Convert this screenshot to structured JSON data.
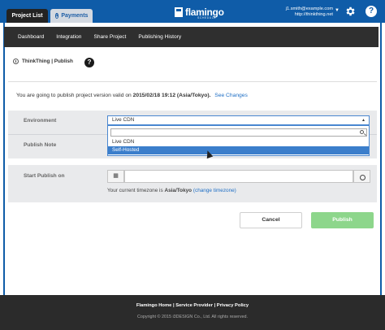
{
  "header": {
    "tabs": [
      {
        "label": "Project List"
      },
      {
        "label": "Payments",
        "icon": "payment-icon"
      }
    ],
    "logo_text": "flamingo",
    "logo_subtext": "SCHEDULE",
    "user_email": "j1.smith@example.com",
    "user_site": "http://thinkthing.net",
    "help_glyph": "?"
  },
  "nav": {
    "items": [
      "Dashboard",
      "Integration",
      "Share Project",
      "Publishing History"
    ]
  },
  "breadcrumb": {
    "text": "ThinkThing | Publish",
    "help": "?"
  },
  "notice": {
    "prefix": "You are going to publish project version valid on",
    "datetime": "2015/02/18 19:12 (Asia/Tokyo).",
    "link": "See Changes"
  },
  "form": {
    "environment_label": "Environment",
    "environment_value": "Live CDN",
    "environment_options": [
      "Live CDN",
      "Self-Hosted"
    ],
    "publish_note_label": "Publish Note",
    "start_publish_label": "Start Publish on",
    "timezone_prefix": "Your current timezone is",
    "timezone_value": "Asia/Tokyo",
    "timezone_link": "(change timezone)"
  },
  "buttons": {
    "cancel": "Cancel",
    "publish": "Publish"
  },
  "footer": {
    "links": "Flamingo Home | Service Provider | Privacy Policy",
    "copyright": "Copyright © 2015 i3DESIGN Co., Ltd. All rights reserved."
  },
  "colors": {
    "brand": "#0f5ca8",
    "publish": "#8dd68b",
    "selected": "#3b7ecb"
  }
}
